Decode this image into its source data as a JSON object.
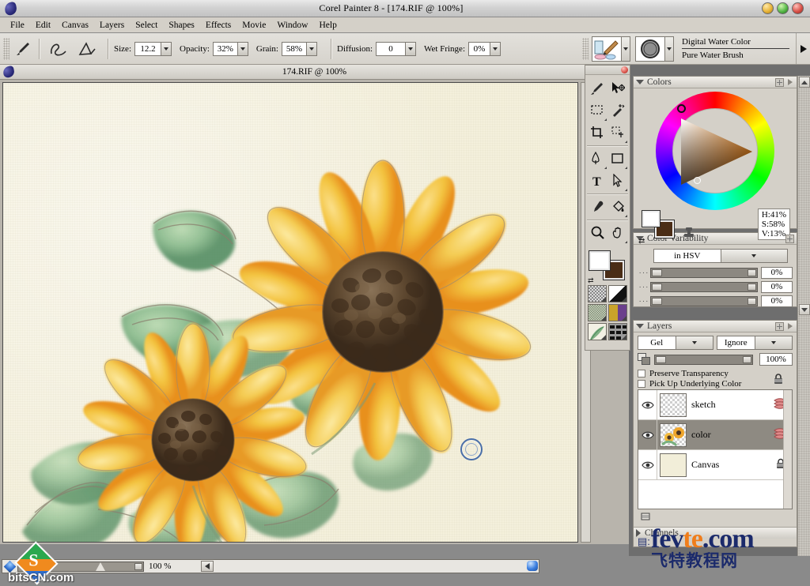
{
  "window": {
    "title": "Corel Painter 8 - [174.RIF @ 100%]",
    "controls": {
      "minimize": "minimize",
      "maximize": "maximize",
      "close": "close"
    }
  },
  "menubar": {
    "items": [
      {
        "label": "File"
      },
      {
        "label": "Edit"
      },
      {
        "label": "Canvas"
      },
      {
        "label": "Layers"
      },
      {
        "label": "Select"
      },
      {
        "label": "Shapes"
      },
      {
        "label": "Effects"
      },
      {
        "label": "Movie"
      },
      {
        "label": "Window"
      },
      {
        "label": "Help"
      }
    ]
  },
  "propertybar": {
    "size_label": "Size:",
    "size_value": "12.2",
    "opacity_label": "Opacity:",
    "opacity_value": "32%",
    "grain_label": "Grain:",
    "grain_value": "58%",
    "diffusion_label": "Diffusion:",
    "diffusion_value": "0",
    "wetfringe_label": "Wet Fringe:",
    "wetfringe_value": "0%",
    "brush_category": "Digital Water Color",
    "brush_variant": "Pure Water Brush"
  },
  "document": {
    "title": "174.RIF @ 100%"
  },
  "toolbox": {
    "tools": [
      {
        "name": "brush",
        "selected": true
      },
      {
        "name": "move-layer"
      },
      {
        "name": "rectangular-selection"
      },
      {
        "name": "magic-wand"
      },
      {
        "name": "crop"
      },
      {
        "name": "selection-adjuster"
      },
      {
        "name": "pen"
      },
      {
        "name": "rectangular-shape"
      },
      {
        "name": "text"
      },
      {
        "name": "shape-selection"
      },
      {
        "name": "dropper"
      },
      {
        "name": "paint-bucket"
      },
      {
        "name": "magnifier"
      },
      {
        "name": "grabber-hand"
      }
    ],
    "swatches": {
      "main_color": "#ffffff",
      "additional_color": "#4a2d16"
    },
    "selectors": [
      {
        "name": "paper-selector"
      },
      {
        "name": "gradient-selector"
      },
      {
        "name": "pattern-selector"
      },
      {
        "name": "weave-selector"
      },
      {
        "name": "nozzle-selector"
      },
      {
        "name": "looks-selector"
      }
    ]
  },
  "panels": {
    "colors": {
      "title": "Colors",
      "hue_label": "H:",
      "hue_value": "41%",
      "sat_label": "S:",
      "sat_value": "58%",
      "val_label": "V:",
      "val_value": "13%",
      "hsv_readout": "H:41%\nS:58%\nV:13%",
      "main_color": "#ffffff",
      "additional_color": "#4a2d16"
    },
    "color_variability": {
      "title": "Color Variability",
      "mode": "in HSV",
      "sliders": [
        {
          "name": "hue-variability",
          "value": "0%"
        },
        {
          "name": "saturation-variability",
          "value": "0%"
        },
        {
          "name": "value-variability",
          "value": "0%"
        }
      ]
    },
    "layers": {
      "title": "Layers",
      "composite_method": "Gel",
      "composite_depth": "Ignore",
      "opacity": "100%",
      "preserve_transparency": "Preserve Transparency",
      "pick_up_underlying": "Pick Up Underlying Color",
      "items": [
        {
          "name": "sketch",
          "visible": true,
          "selected": false
        },
        {
          "name": "color",
          "visible": true,
          "selected": true
        },
        {
          "name": "Canvas",
          "visible": true,
          "selected": false,
          "locked": true
        }
      ],
      "channels_tab": "Channels"
    }
  },
  "statusbar": {
    "zoom_value": "100 %"
  },
  "watermarks": {
    "bitscn": "bitsCN.com",
    "fevte_part1": "fev",
    "fevte_part2": "te",
    "fevte_part3": ".com",
    "fevte_cn": "飞特教程网"
  },
  "artwork": {
    "description": "Watercolor painting of two sunflowers with green leaves on textured paper",
    "colors": {
      "petal_light": "#f7d35c",
      "petal_mid": "#f2ae30",
      "petal_deep": "#e8871e",
      "center_dark": "#4a3424",
      "center_mid": "#6b5238",
      "leaf_green": "#7fb184",
      "leaf_deep": "#4e8a5c",
      "sketch_line": "#8a7f6e",
      "paper": "#f4f0dc"
    }
  }
}
